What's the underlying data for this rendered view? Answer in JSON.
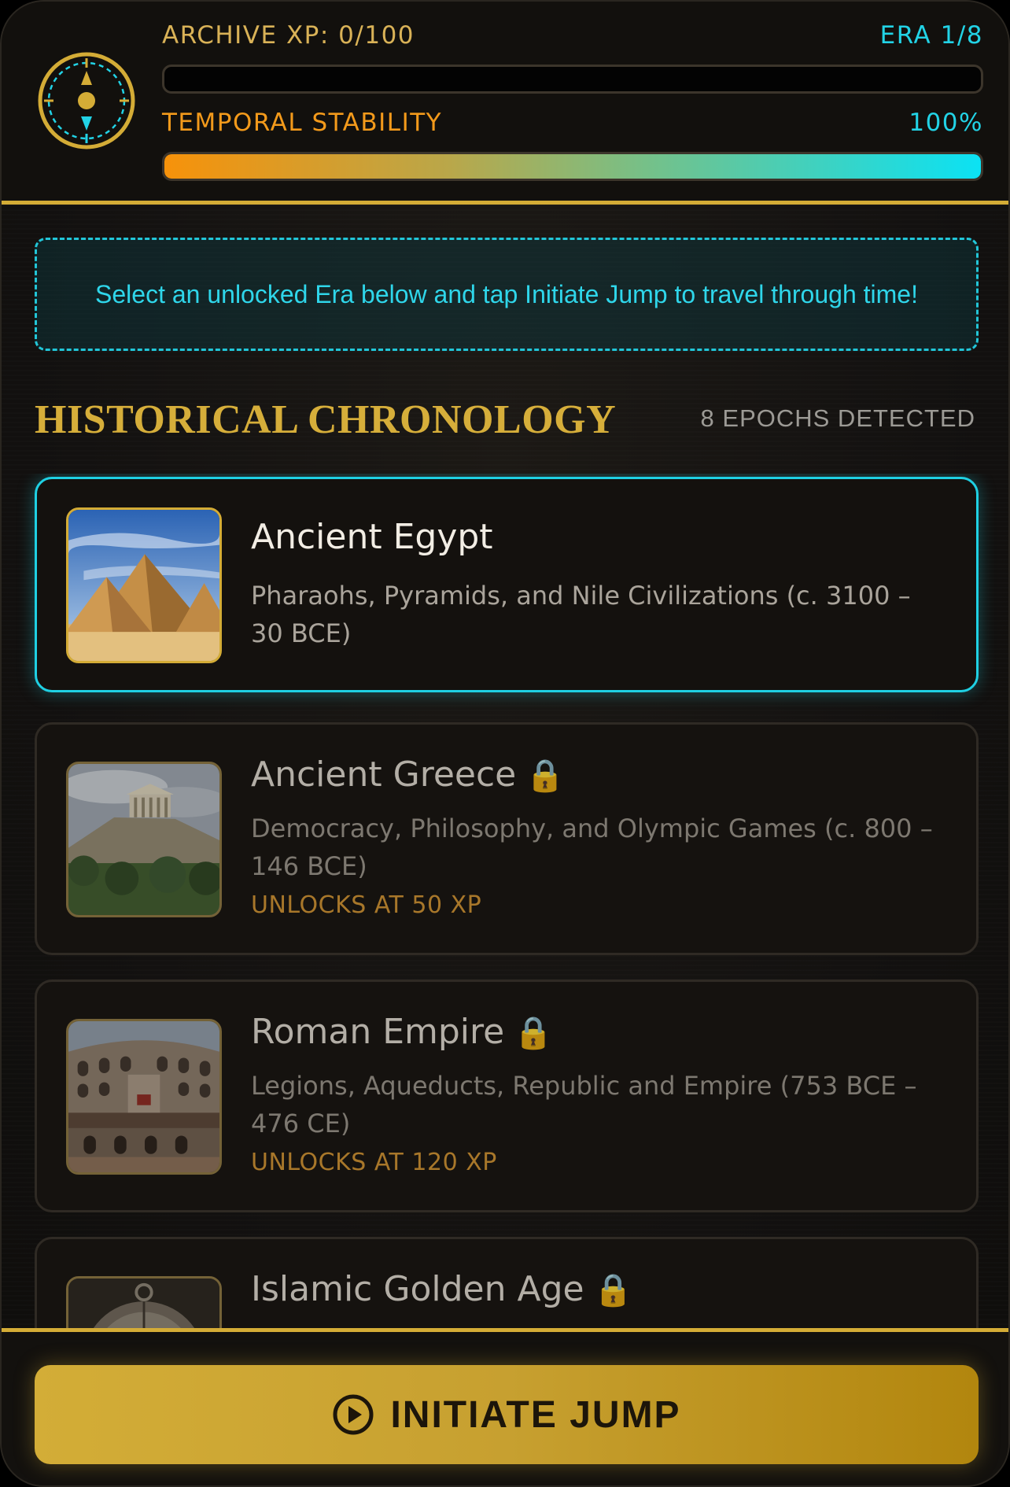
{
  "header": {
    "xp_label": "ARCHIVE XP: 0/100",
    "xp_progress": 0,
    "era_label": "ERA 1/8",
    "stability_label": "TEMPORAL STABILITY",
    "stability_value": "100%",
    "stability_progress": 1.0,
    "icon": "compass-icon"
  },
  "hint": {
    "text": "Select an unlocked Era below and tap Initiate Jump to travel through time!"
  },
  "section": {
    "title": "HISTORICAL CHRONOLOGY",
    "count": "8 EPOCHS DETECTED"
  },
  "eras": [
    {
      "name": "Ancient Egypt",
      "description": "Pharaohs, Pyramids, and Nile Civilizations (c. 3100 – 30 BCE)",
      "locked": false,
      "selected": true,
      "unlock": ""
    },
    {
      "name": "Ancient Greece",
      "description": "Democracy, Philosophy, and Olympic Games (c. 800 – 146 BCE)",
      "locked": true,
      "selected": false,
      "unlock": "UNLOCKS AT 50 XP"
    },
    {
      "name": "Roman Empire",
      "description": "Legions, Aqueducts, Republic and Empire (753 BCE – 476 CE)",
      "locked": true,
      "selected": false,
      "unlock": "UNLOCKS AT 120 XP"
    },
    {
      "name": "Islamic Golden Age",
      "description": "",
      "locked": true,
      "selected": false,
      "unlock": ""
    }
  ],
  "footer": {
    "button_label": "INITIATE JUMP",
    "button_icon": "play-circle-icon"
  },
  "colors": {
    "gold": "#d4ac36",
    "cyan": "#1fd0e3",
    "orange": "#f39a1b"
  }
}
